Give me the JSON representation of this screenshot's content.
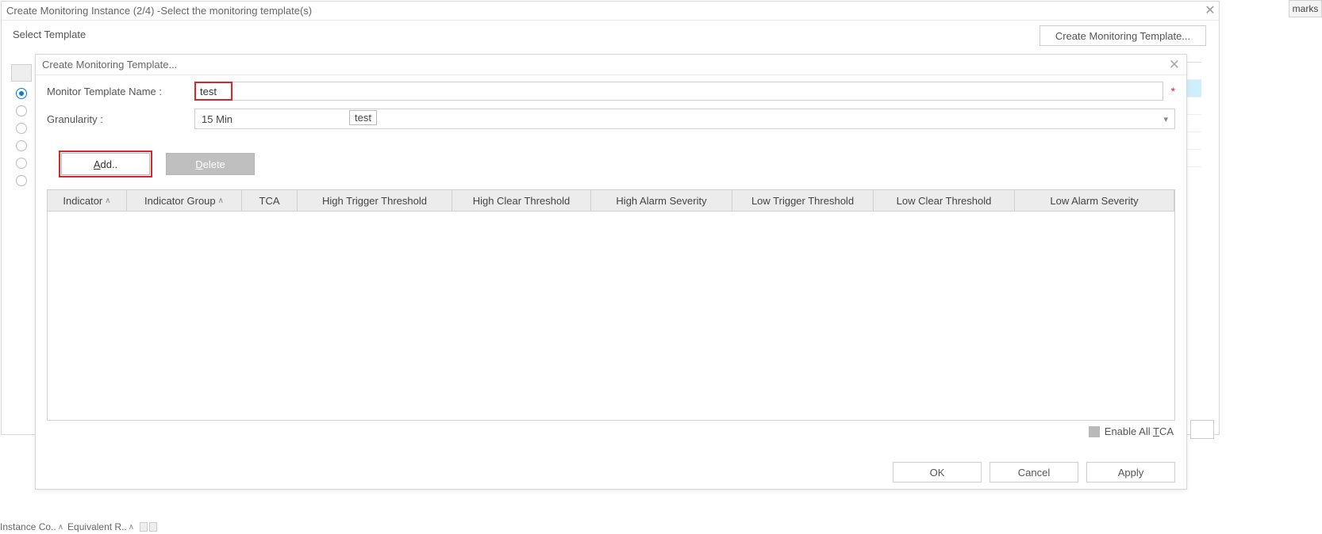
{
  "tab_remnant": "marks",
  "wizard": {
    "title": "Create Monitoring Instance (2/4) -Select the monitoring template(s)",
    "section_label": "Select Template",
    "create_template_btn": "Create Monitoring Template..."
  },
  "dialog": {
    "title": "Create Monitoring Template...",
    "name_label": "Monitor Template Name :",
    "name_value": "test",
    "granularity_label": "Granularity :",
    "granularity_value": "15 Min",
    "tooltip_text": "test",
    "add_btn_full": "Add..",
    "add_btn_first": "A",
    "add_btn_rest": "dd..",
    "delete_btn_first": "D",
    "delete_btn_rest": "elete",
    "columns": {
      "c0": "Indicator",
      "c1": "Indicator Group",
      "c2": "TCA",
      "c3": "High Trigger Threshold",
      "c4": "High Clear Threshold",
      "c5": "High Alarm Severity",
      "c6": "Low Trigger Threshold",
      "c7": "Low Clear Threshold",
      "c8": "Low Alarm Severity"
    },
    "enable_all_pre": "Enable All ",
    "enable_all_first": "T",
    "enable_all_rest": "CA",
    "ok": "OK",
    "cancel": "Cancel",
    "apply": "Apply"
  },
  "bottom": {
    "col1": "Instance Co..",
    "col2": "Equivalent R.."
  }
}
